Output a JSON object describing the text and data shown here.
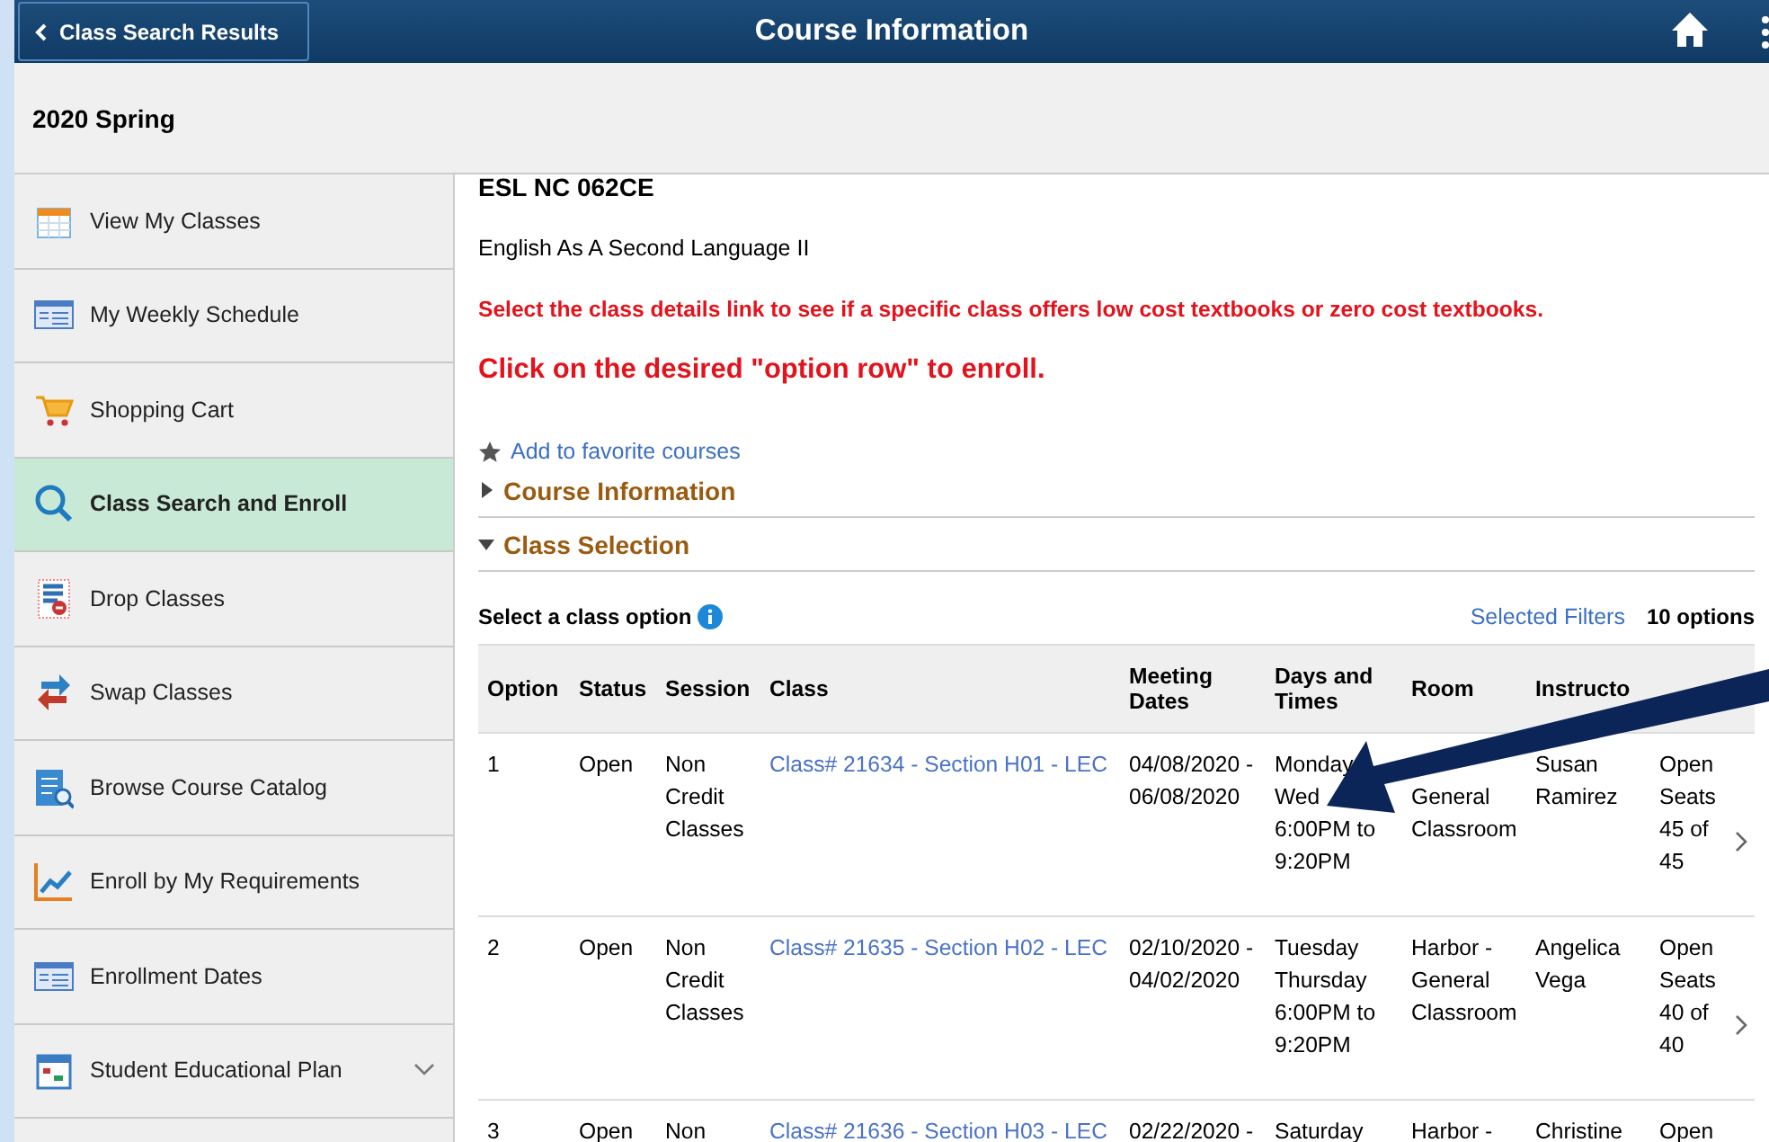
{
  "header": {
    "back": "Class Search Results",
    "title": "Course Information"
  },
  "term": "2020 Spring",
  "sidebar": {
    "items": [
      {
        "label": "View My Classes",
        "kind": "calendar",
        "selected": false
      },
      {
        "label": "My Weekly Schedule",
        "kind": "schedule",
        "selected": false
      },
      {
        "label": "Shopping Cart",
        "kind": "cart",
        "selected": false
      },
      {
        "label": "Class Search and Enroll",
        "kind": "search",
        "selected": true
      },
      {
        "label": "Drop Classes",
        "kind": "drop",
        "selected": false
      },
      {
        "label": "Swap Classes",
        "kind": "swap",
        "selected": false
      },
      {
        "label": "Browse Course Catalog",
        "kind": "catalog",
        "selected": false
      },
      {
        "label": "Enroll by My Requirements",
        "kind": "chart",
        "selected": false
      },
      {
        "label": "Enrollment Dates",
        "kind": "schedule",
        "selected": false
      },
      {
        "label": "Student Educational Plan",
        "kind": "plan",
        "selected": false,
        "expandable": true
      }
    ]
  },
  "course": {
    "code": "ESL NC 062CE",
    "name": "English As A Second Language II",
    "notice": "Select the class details link to see if a specific class offers low cost textbooks or zero cost textbooks.",
    "instruction": "Click on the desired \"option row\" to enroll.",
    "favorite": "Add to favorite courses",
    "sections": [
      {
        "title": "Course Information",
        "expanded": false
      },
      {
        "title": "Class Selection",
        "expanded": true
      }
    ]
  },
  "class_options": {
    "label": "Select a class option",
    "filters": "Selected Filters",
    "count": "10 options",
    "columns": [
      "Option",
      "Status",
      "Session",
      "Class",
      "Meeting\nDates",
      "Days and\nTimes",
      "Room",
      "Instructo"
    ],
    "rows": [
      {
        "option": "1",
        "status": "Open",
        "session": "Non\nCredit\nClasses",
        "class": "Class# 21634 - Section H01 - LEC",
        "dates": "04/08/2020 -\n06/08/2020",
        "times": "Monday\nWed\n6:00PM to\n9:20PM",
        "room": "\nGeneral\nClassroom",
        "instructor": "Susan\nRamirez",
        "seats": "Open\nSeats\n45 of\n45"
      },
      {
        "option": "2",
        "status": "Open",
        "session": "Non\nCredit\nClasses",
        "class": "Class# 21635 - Section H02 - LEC",
        "dates": "02/10/2020 -\n04/02/2020",
        "times": "Tuesday\nThursday\n6:00PM to\n9:20PM",
        "room": "Harbor -\nGeneral\nClassroom",
        "instructor": "Angelica\nVega",
        "seats": "Open\nSeats\n40 of\n40"
      },
      {
        "option": "3",
        "status": "Open",
        "session": "Non",
        "class": "Class# 21636 - Section H03 - LEC",
        "dates": "02/22/2020 -",
        "times": "Saturday",
        "room": "Harbor -",
        "instructor": "Christine",
        "seats": "Open"
      }
    ]
  }
}
